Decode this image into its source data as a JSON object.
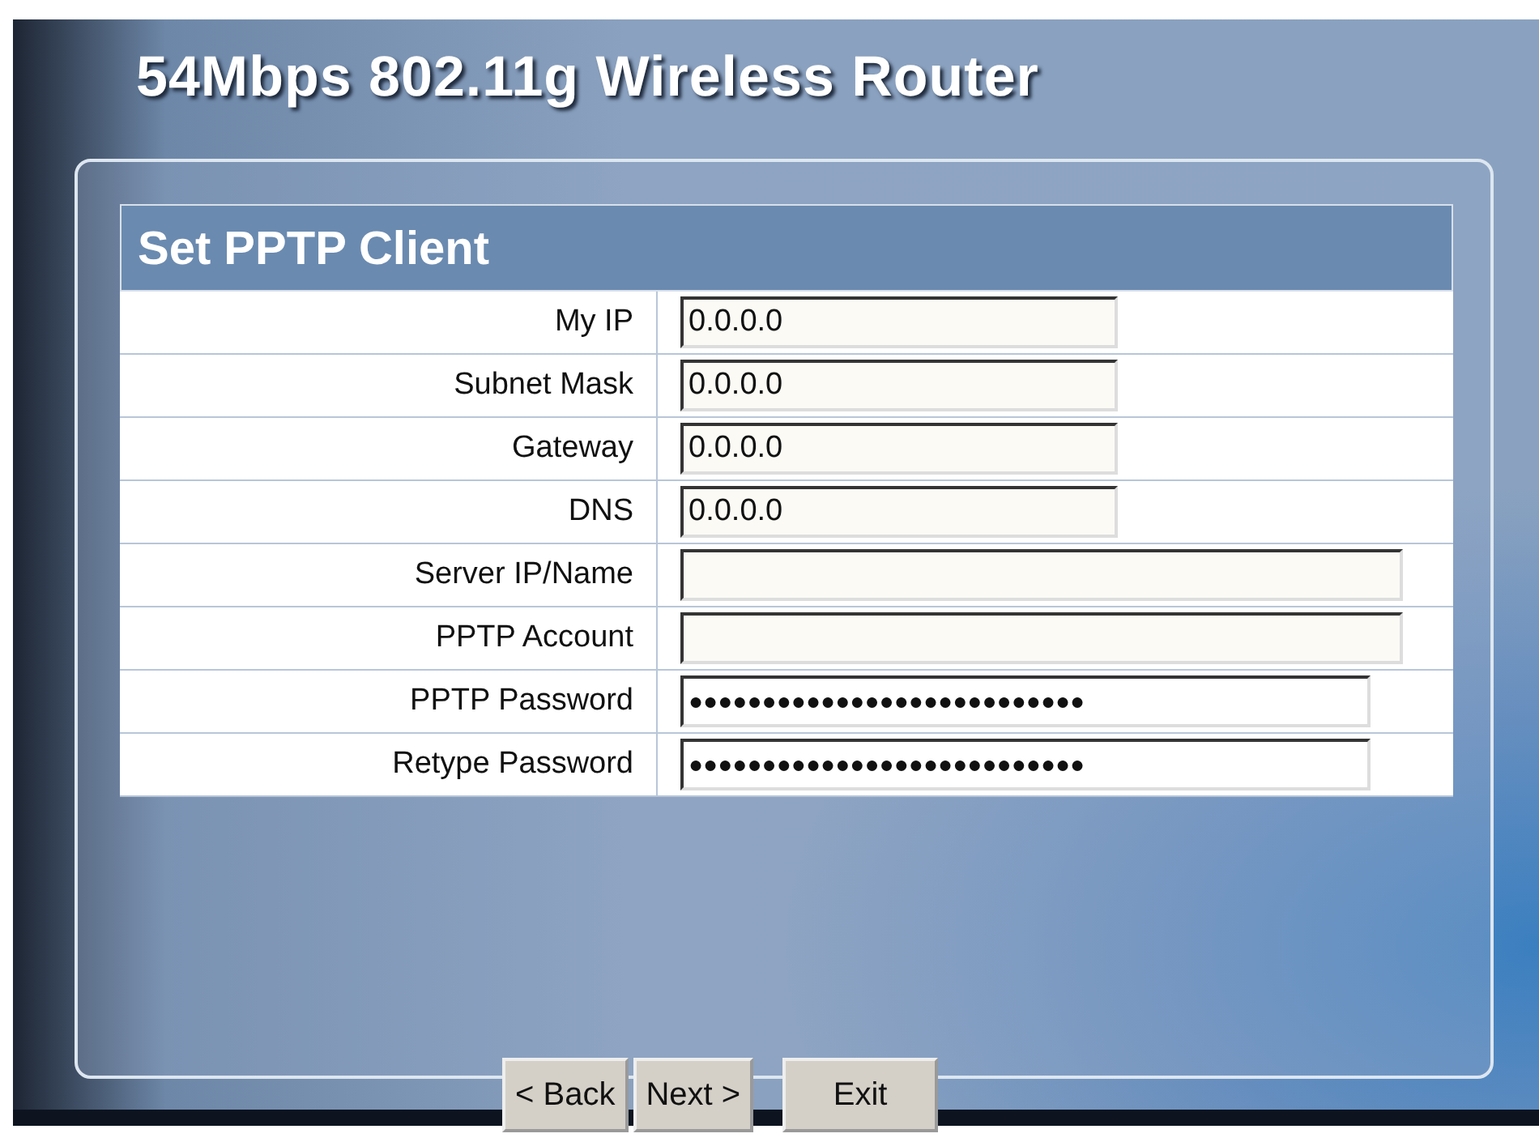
{
  "header": {
    "title": "54Mbps 802.11g Wireless Router"
  },
  "form": {
    "title": "Set PPTP Client",
    "rows": [
      {
        "label": "My IP",
        "value": "0.0.0.0",
        "kind": "short"
      },
      {
        "label": "Subnet Mask",
        "value": "0.0.0.0",
        "kind": "short"
      },
      {
        "label": "Gateway",
        "value": "0.0.0.0",
        "kind": "short"
      },
      {
        "label": "DNS",
        "value": "0.0.0.0",
        "kind": "short"
      },
      {
        "label": "Server IP/Name",
        "value": "",
        "kind": "long"
      },
      {
        "label": "PPTP Account",
        "value": "",
        "kind": "long"
      },
      {
        "label": "PPTP Password",
        "value": "●●●●●●●●●●●●●●●●●●●●●●●●●●●",
        "kind": "password"
      },
      {
        "label": "Retype Password",
        "value": "●●●●●●●●●●●●●●●●●●●●●●●●●●●",
        "kind": "password"
      }
    ]
  },
  "buttons": [
    "< Back",
    "Next >",
    "Exit"
  ]
}
